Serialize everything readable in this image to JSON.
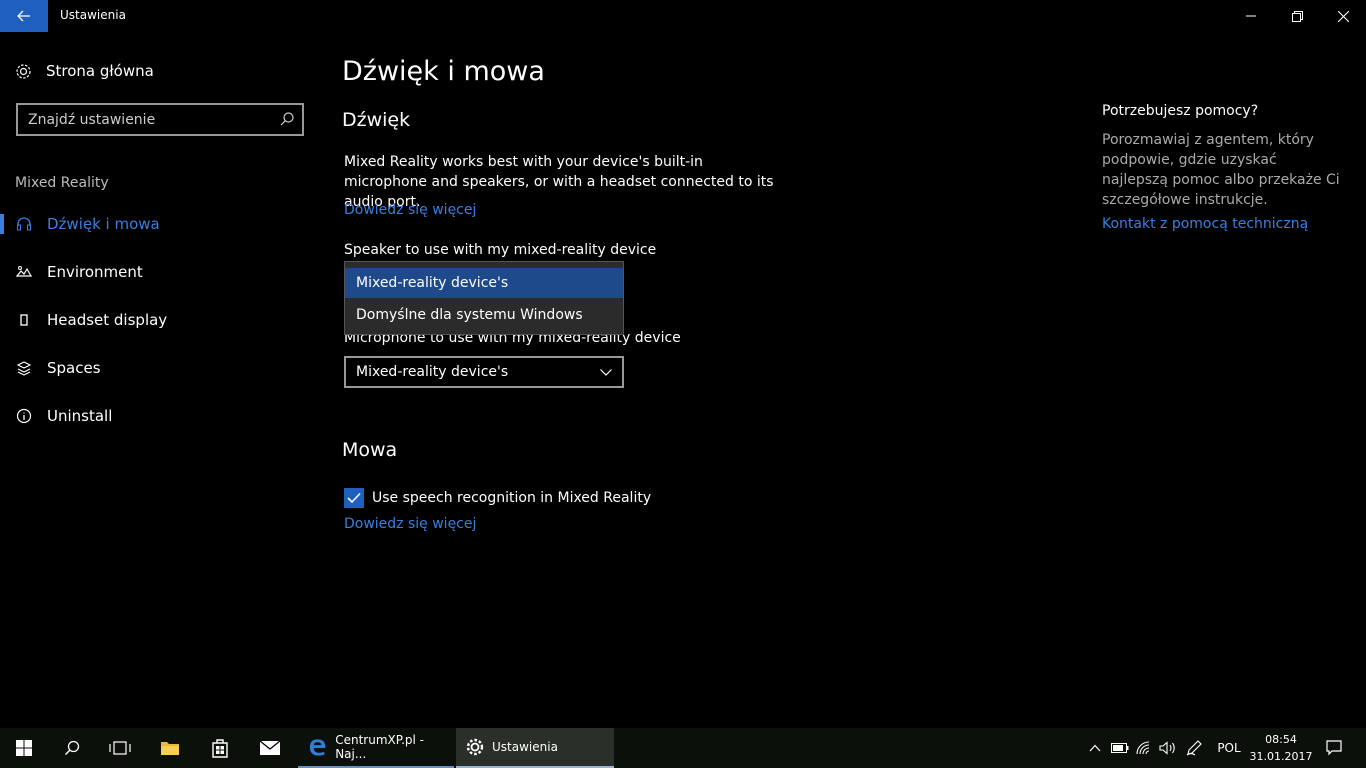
{
  "window": {
    "title": "Ustawienia"
  },
  "sidebar": {
    "home_label": "Strona główna",
    "search_placeholder": "Znajdź ustawienie",
    "group_label": "Mixed Reality",
    "items": [
      {
        "label": "Dźwięk i mowa",
        "icon": "headset-icon",
        "active": true
      },
      {
        "label": "Environment",
        "icon": "environment-icon",
        "active": false
      },
      {
        "label": "Headset display",
        "icon": "display-icon",
        "active": false
      },
      {
        "label": "Spaces",
        "icon": "spaces-icon",
        "active": false
      },
      {
        "label": "Uninstall",
        "icon": "info-icon",
        "active": false
      }
    ]
  },
  "main": {
    "page_title": "Dźwięk i mowa",
    "sound_heading": "Dźwięk",
    "sound_description": "Mixed Reality works best with your device's built-in microphone and speakers, or with a headset connected to its audio port.",
    "learn_more_1": "Dowiedz się więcej",
    "speaker_label": "Speaker to use with my mixed-reality device",
    "speaker_options": [
      "Mixed-reality device's",
      "Domyślne dla systemu Windows"
    ],
    "microphone_label": "Microphone to use with my mixed-reality device",
    "microphone_value": "Mixed-reality device's",
    "speech_heading": "Mowa",
    "speech_checkbox_label": "Use speech recognition in Mixed Reality",
    "speech_checked": true,
    "learn_more_2": "Dowiedz się więcej"
  },
  "help": {
    "title": "Potrzebujesz pomocy?",
    "text": "Porozmawiaj z agentem, który podpowie, gdzie uzyskać najlepszą pomoc albo przekaże Ci szczegółowe instrukcje.",
    "link": "Kontakt z pomocą techniczną"
  },
  "taskbar": {
    "apps": [
      {
        "label": "CentrumXP.pl - Naj...",
        "icon": "edge-icon"
      },
      {
        "label": "Ustawienia",
        "icon": "gear-icon"
      }
    ],
    "language": "POL",
    "time": "08:54",
    "date": "31.01.2017"
  },
  "colors": {
    "accent": "#3a7fe0",
    "selected_option": "#1e4a8c",
    "back_button": "#1f5fbf"
  }
}
